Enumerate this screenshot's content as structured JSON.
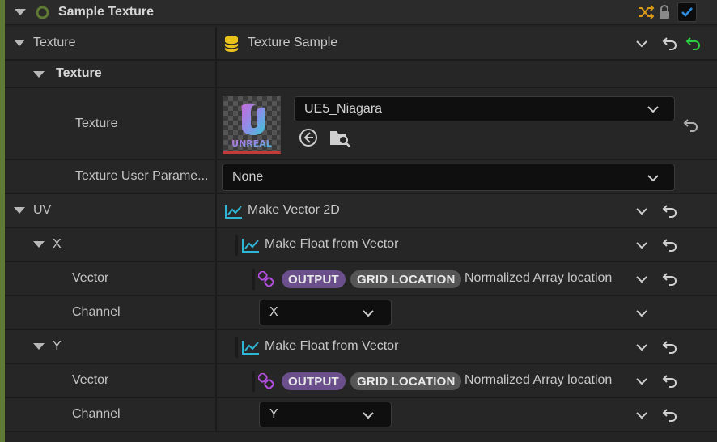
{
  "header": {
    "title": "Sample Texture",
    "icons": [
      "collapse-triangle-icon",
      "circle-icon",
      "shuffle-icon",
      "lock-icon",
      "enabled-checkbox"
    ],
    "enabled": true,
    "accent": "#5f7a33"
  },
  "rows": {
    "texture_param": {
      "label": "Texture",
      "value": "Texture Sample"
    },
    "texture_group": {
      "label": "Texture"
    },
    "texture_asset": {
      "label": "Texture",
      "asset": "UE5_Niagara",
      "thumb_text": "UNREAL"
    },
    "user_param": {
      "label": "Texture User Parame...",
      "value": "None"
    },
    "uv": {
      "label": "UV",
      "value": "Make Vector 2D"
    },
    "x": {
      "label": "X",
      "value": "Make Float from Vector"
    },
    "x_vector": {
      "label": "Vector",
      "pill1": "OUTPUT",
      "pill2": "GRID LOCATION",
      "value": "Normalized Array location"
    },
    "x_channel": {
      "label": "Channel",
      "value": "X"
    },
    "y": {
      "label": "Y",
      "value": "Make Float from Vector"
    },
    "y_vector": {
      "label": "Vector",
      "pill1": "OUTPUT",
      "pill2": "GRID LOCATION",
      "value": "Normalized Array location"
    },
    "y_channel": {
      "label": "Channel",
      "value": "Y"
    }
  },
  "colors": {
    "output_pill": "#6b4f8c",
    "grid_pill": "#555555",
    "graph_icon": "#2fb5d6",
    "link_icon": "#b44ee0",
    "database_icon": "#e8c21a",
    "reset_green": "#2ecc40"
  }
}
